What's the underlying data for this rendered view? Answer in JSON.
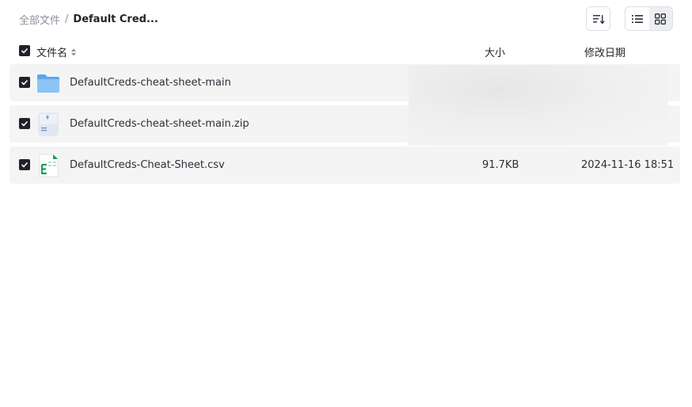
{
  "breadcrumb": {
    "root": "全部文件",
    "separator": "/",
    "current": "Default Cred..."
  },
  "toolbar": {
    "sort_icon": "sort-icon",
    "list_view_icon": "list-view-icon",
    "grid_view_icon": "grid-view-icon"
  },
  "table": {
    "columns": {
      "name": "文件名",
      "size": "大小",
      "date": "修改日期"
    },
    "rows": [
      {
        "name": "DefaultCreds-cheat-sheet-main",
        "icon": "folder-icon",
        "size": "",
        "date": ""
      },
      {
        "name": "DefaultCreds-cheat-sheet-main.zip",
        "icon": "zip-file-icon",
        "size": "",
        "date": ""
      },
      {
        "name": "DefaultCreds-Cheat-Sheet.csv",
        "icon": "spreadsheet-file-icon",
        "size": "91.7KB",
        "date": "2024-11-16 18:51"
      }
    ]
  },
  "colors": {
    "row_bg": "#f4f4f5",
    "checkbox": "#1f2329",
    "folder": "#6aaef2",
    "csv_green": "#1f9d55"
  }
}
